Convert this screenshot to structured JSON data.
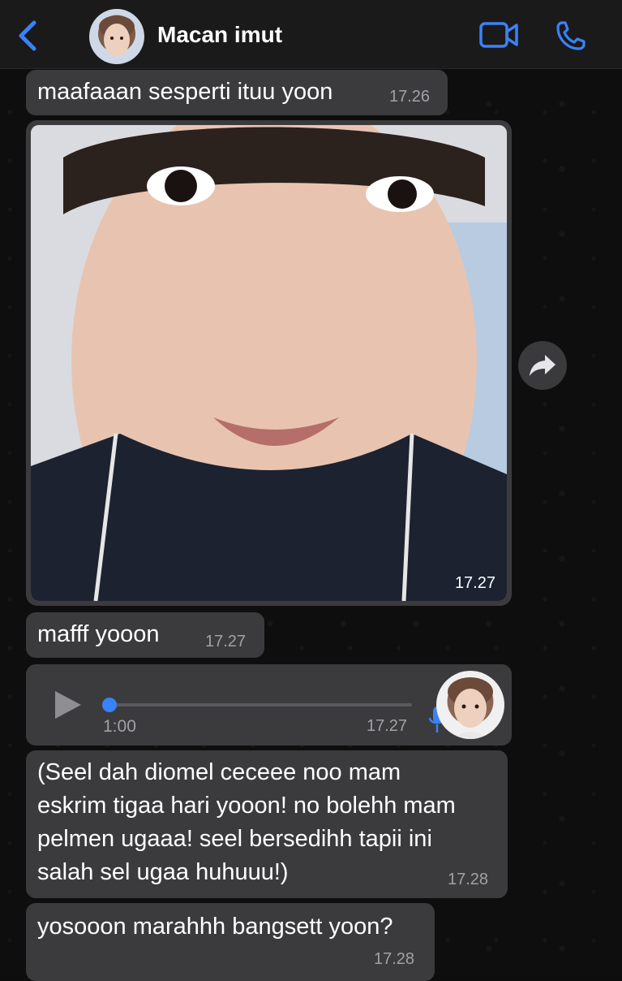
{
  "header": {
    "contact_name": "Macan imut",
    "back_icon": "chevron-left-icon",
    "video_icon": "video-camera-icon",
    "call_icon": "phone-icon",
    "accent_color": "#3a82f7"
  },
  "messages": [
    {
      "type": "text",
      "text": "maafaaan sesperti ituu yoon",
      "time": "17.26"
    },
    {
      "type": "photo",
      "time": "17.27"
    },
    {
      "type": "text",
      "text": "mafff yooon",
      "time": "17.27"
    },
    {
      "type": "voice",
      "duration": "1:00",
      "time": "17.27",
      "progress": 0
    },
    {
      "type": "text",
      "lines": [
        "(Seel dah diomel ceceee noo mam",
        "eskrim tigaa hari yooon! no bolehh mam",
        "pelmen ugaaa! seel bersedihh tapii ini",
        "salah sel ugaa huhuuu!)"
      ],
      "time": "17.28"
    },
    {
      "type": "text",
      "text": "yosooon marahhh bangsett yoon?",
      "time": "17.28"
    }
  ]
}
